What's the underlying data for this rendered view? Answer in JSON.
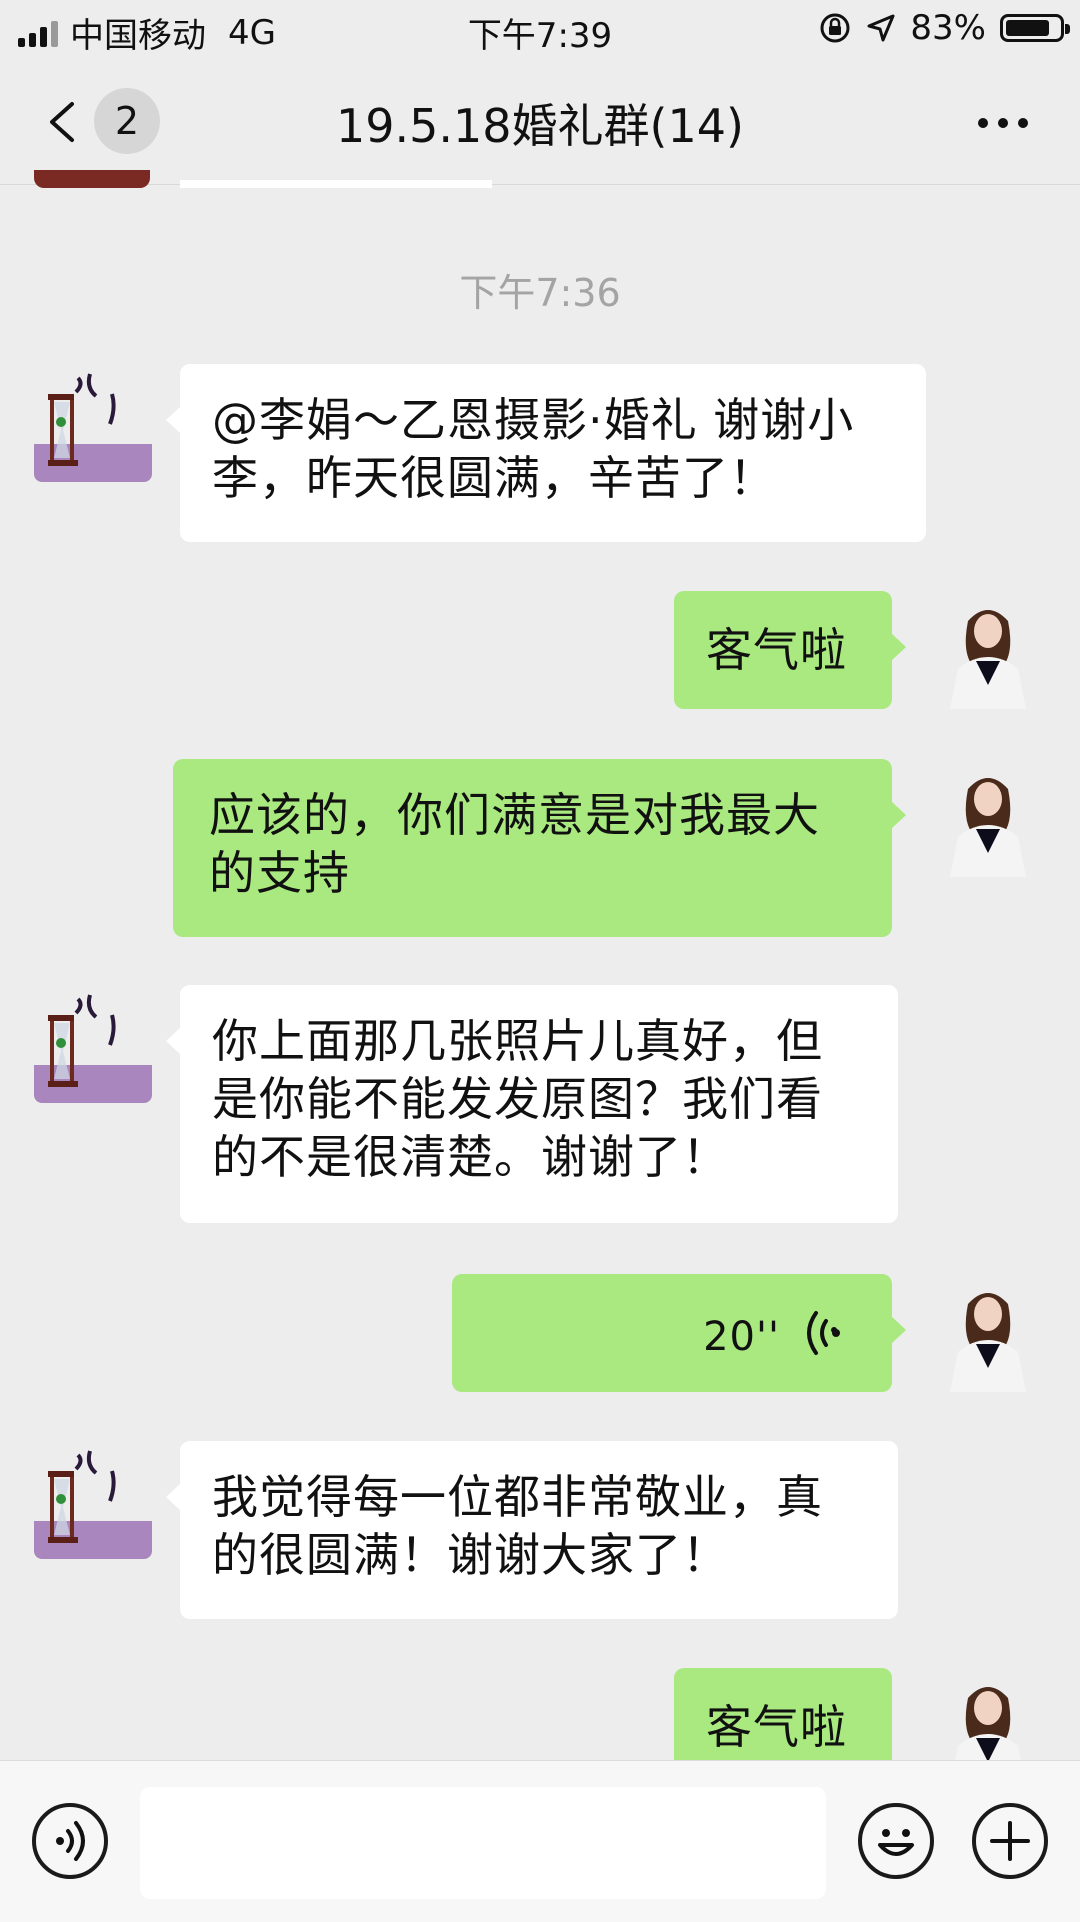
{
  "status_bar": {
    "carrier": "中国移动",
    "network": "4G",
    "time": "下午7:39",
    "battery": "83%",
    "battery_level": 0.83
  },
  "nav": {
    "back_icon": "chevron-left-icon",
    "unread_count": "2",
    "title": "19.5.18婚礼群(14)",
    "more_icon": "ellipsis-icon"
  },
  "chat": {
    "timestamp": "下午7:36",
    "messages": [
      {
        "side": "left",
        "type": "text",
        "text": "@李娟～乙恩摄影·婚礼 谢谢小李，昨天很圆满，辛苦了！"
      },
      {
        "side": "right",
        "type": "text",
        "text": "客气啦"
      },
      {
        "side": "right",
        "type": "text",
        "text": "应该的，你们满意是对我最大的支持"
      },
      {
        "side": "left",
        "type": "text",
        "text": "你上面那几张照片儿真好，但是你能不能发发原图？我们看的不是很清楚。谢谢了！"
      },
      {
        "side": "right",
        "type": "voice",
        "duration": "20''"
      },
      {
        "side": "left",
        "type": "text",
        "text": "我觉得每一位都非常敬业，真的很圆满！谢谢大家了！"
      },
      {
        "side": "right",
        "type": "text",
        "text": "客气啦"
      }
    ]
  },
  "input_bar": {
    "voice_icon": "voice-input-icon",
    "placeholder": "",
    "emoji_icon": "emoji-icon",
    "plus_icon": "plus-icon"
  },
  "colors": {
    "background": "#ededed",
    "bubble_self": "#a9e97f",
    "bubble_other": "#ffffff",
    "timestamp": "#a4a4a4"
  }
}
